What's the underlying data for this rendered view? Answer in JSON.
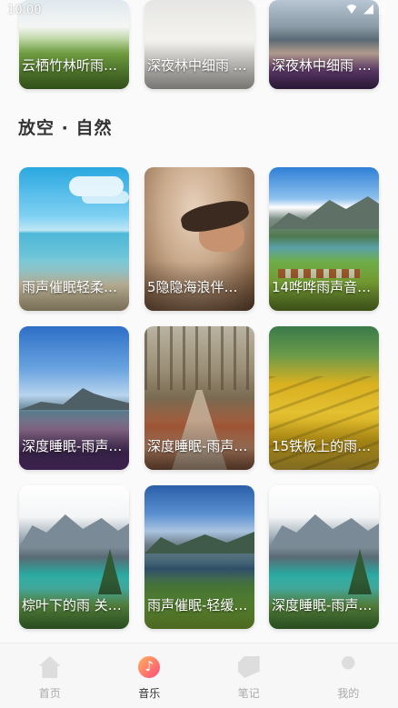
{
  "status_bar": {
    "time": "10:00"
  },
  "top_row": [
    {
      "title": "云栖竹林听雨…",
      "icon": "bamboo-scene"
    },
    {
      "title": "深夜林中细雨 …",
      "icon": "bed-scene"
    },
    {
      "title": "深夜林中细雨 …",
      "icon": "mountain-scene"
    }
  ],
  "section": {
    "title": "放空 · 自然"
  },
  "cards": [
    {
      "title": "雨声催眠轻柔…"
    },
    {
      "title": "5隐隐海浪伴…"
    },
    {
      "title": "14哗哗雨声音…"
    },
    {
      "title": "深度睡眠-雨声…"
    },
    {
      "title": "深度睡眠-雨声…"
    },
    {
      "title": "15铁板上的雨…"
    },
    {
      "title": "棕叶下的雨 关…"
    },
    {
      "title": "雨声催眠-轻缓…"
    },
    {
      "title": "深度睡眠-雨声…"
    }
  ],
  "bottom_nav": {
    "items": [
      {
        "label": "首页",
        "icon": "home-icon"
      },
      {
        "label": "音乐",
        "icon": "music-icon"
      },
      {
        "label": "笔记",
        "icon": "note-icon"
      },
      {
        "label": "我的",
        "icon": "profile-icon"
      }
    ],
    "active": "音乐"
  }
}
